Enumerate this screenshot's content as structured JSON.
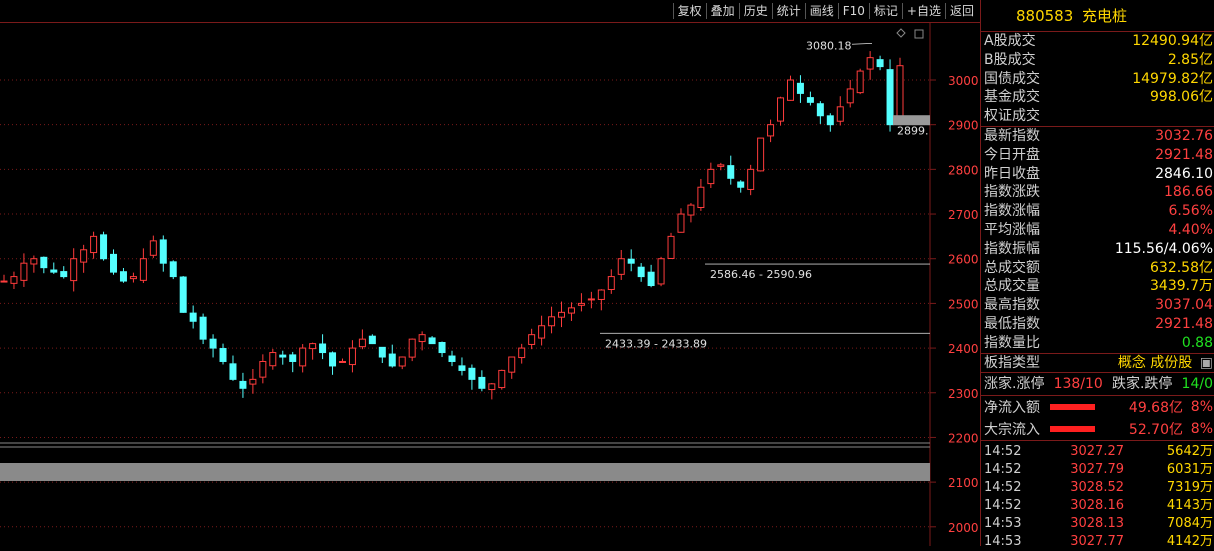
{
  "toolbar": [
    "复权",
    "叠加",
    "历史",
    "统计",
    "画线",
    "F10",
    "标记",
    "+自选",
    "返回"
  ],
  "chart": {
    "y_ticks": [
      "3000",
      "2900",
      "2800",
      "2700",
      "2600",
      "2500",
      "2400",
      "2300",
      "2200",
      "2100",
      "2000"
    ],
    "high_label": "3080.18",
    "current_label": "2899.",
    "gap1_label": "2586.46 - 2590.96",
    "gap2_label": "2433.39 - 2433.89",
    "colors": {
      "up": "#ff3c3c",
      "down": "#54ffff",
      "grid": "#7a1a1a",
      "axis": "#7a1a1a"
    }
  },
  "chart_data": {
    "type": "candlestick",
    "y_range": [
      2000,
      3100
    ],
    "last_close": 3032.76,
    "high": 3080.18,
    "support_lines": [
      2586.46,
      2433.39
    ]
  },
  "panel": {
    "code": "880583",
    "name": "充电桩",
    "volume_rows": [
      {
        "label": "A股成交",
        "value": "12490.94亿",
        "color": "y"
      },
      {
        "label": "B股成交",
        "value": "2.85亿",
        "color": "y"
      },
      {
        "label": "国债成交",
        "value": "14979.82亿",
        "color": "y"
      },
      {
        "label": "基金成交",
        "value": "998.06亿",
        "color": "y"
      },
      {
        "label": "权证成交",
        "value": "",
        "color": "y"
      }
    ],
    "index_rows": [
      {
        "label": "最新指数",
        "value": "3032.76",
        "color": "r"
      },
      {
        "label": "今日开盘",
        "value": "2921.48",
        "color": "r"
      },
      {
        "label": "昨日收盘",
        "value": "2846.10",
        "color": "w"
      },
      {
        "label": "指数涨跌",
        "value": "186.66",
        "color": "r"
      },
      {
        "label": "指数涨幅",
        "value": "6.56%",
        "color": "r"
      },
      {
        "label": "平均涨幅",
        "value": "4.40%",
        "color": "r"
      },
      {
        "label": "指数振幅",
        "value": "115.56/4.06%",
        "color": "w"
      },
      {
        "label": "总成交额",
        "value": "632.58亿",
        "color": "y"
      },
      {
        "label": "总成交量",
        "value": "3439.7万",
        "color": "y"
      },
      {
        "label": "最高指数",
        "value": "3037.04",
        "color": "r"
      },
      {
        "label": "最低指数",
        "value": "2921.48",
        "color": "r"
      },
      {
        "label": "指数量比",
        "value": "0.88",
        "color": "g"
      }
    ],
    "type_row": {
      "label": "板指类型",
      "value": "概念 成份股",
      "extra": "▣"
    },
    "updown_row": {
      "label1": "涨家.涨停",
      "val1": "138/10",
      "label2": "跌家.跌停",
      "val2": "14/0"
    },
    "flows": [
      {
        "label": "净流入额",
        "value": "49.68亿",
        "pct": "8%"
      },
      {
        "label": "大宗流入",
        "value": "52.70亿",
        "pct": "8%"
      }
    ],
    "ticks": [
      {
        "time": "14:52",
        "price": "3027.27",
        "vol": "5642万"
      },
      {
        "time": "14:52",
        "price": "3027.79",
        "vol": "6031万"
      },
      {
        "time": "14:52",
        "price": "3028.52",
        "vol": "7319万"
      },
      {
        "time": "14:52",
        "price": "3028.16",
        "vol": "4143万"
      },
      {
        "time": "14:53",
        "price": "3028.13",
        "vol": "7084万"
      },
      {
        "time": "14:53",
        "price": "3027.77",
        "vol": "4142万"
      }
    ]
  }
}
